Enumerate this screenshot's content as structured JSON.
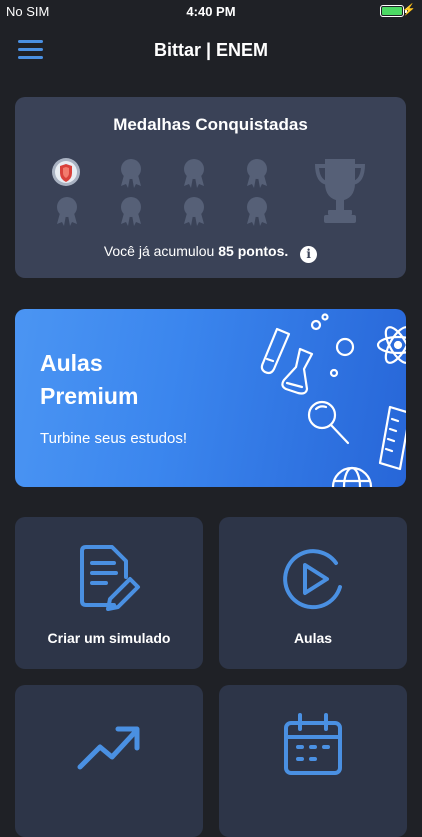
{
  "status_bar": {
    "carrier": "No SIM",
    "time": "4:40 PM",
    "battery_color": "#4cd964"
  },
  "header": {
    "title": "Bittar | ENEM",
    "menu_icon": "hamburger-icon"
  },
  "medals_card": {
    "title": "Medalhas Conquistadas",
    "points_prefix": "Você já acumulou",
    "points_value": "85 pontos.",
    "earned_count": 1,
    "total_medals": 8
  },
  "premium_banner": {
    "title": "Aulas Premium",
    "subtitle": "Turbine seus estudos!"
  },
  "tiles": [
    {
      "label": "Criar um simulado",
      "icon": "document-edit-icon"
    },
    {
      "label": "Aulas",
      "icon": "play-circle-icon"
    },
    {
      "label": "",
      "icon": "trending-up-icon"
    },
    {
      "label": "",
      "icon": "calendar-icon"
    }
  ],
  "colors": {
    "background": "#1f2126",
    "card": "#3a4257",
    "tile": "#2d3548",
    "accent": "#4a90e2"
  }
}
